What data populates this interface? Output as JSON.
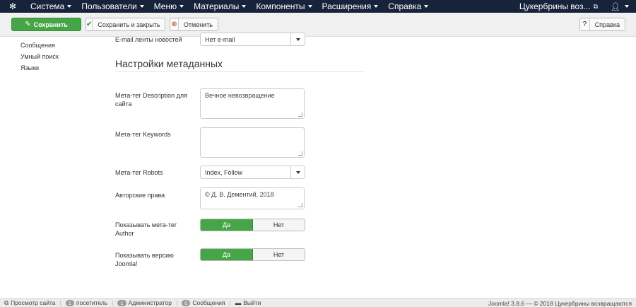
{
  "navbar": {
    "logo_icon": "joomla-logo-icon",
    "menu": [
      "Система",
      "Пользователи",
      "Меню",
      "Материалы",
      "Компоненты",
      "Расширения",
      "Справка"
    ],
    "site_name": "Цукербрины воз...",
    "user_icon": "user-icon"
  },
  "toolbar": {
    "save_label": "Сохранить",
    "save_close_label": "Сохранить и закрыть",
    "cancel_label": "Отменить",
    "help_label": "Справка"
  },
  "sidebar": {
    "items": [
      "Сообщения",
      "Умный поиск",
      "Языки"
    ]
  },
  "form": {
    "email_feed_label": "E-mail ленты новостей",
    "email_feed_value": "Нет e-mail",
    "section_title": "Настройки метаданных",
    "meta_description_label": "Мета-тег Description для сайта",
    "meta_description_value": "Вечное невозвращение",
    "meta_keywords_label": "Мета-тег Keywords",
    "meta_keywords_value": "",
    "meta_robots_label": "Мета-тег Robots",
    "meta_robots_value": "Index, Follow",
    "rights_label": "Авторские права",
    "rights_value": "© Д. В. Дементий, 2018",
    "show_author_label": "Показывать мета-тег Author",
    "show_version_label": "Показывать версию Joomla!",
    "yes_label": "Да",
    "no_label": "Нет"
  },
  "statusbar": {
    "preview_label": "Просмотр сайта",
    "visitors_count": "1",
    "visitors_label": "посетитель",
    "admins_count": "1",
    "admins_label": "Администратор",
    "messages_count": "0",
    "messages_label": "Сообщения",
    "logout_label": "Выйти",
    "footer_text": "Joomla! 3.8.6  —  © 2018 Цукербрины возвращаются"
  },
  "colors": {
    "navbar_bg": "#17223b",
    "success_green": "#46a546"
  }
}
